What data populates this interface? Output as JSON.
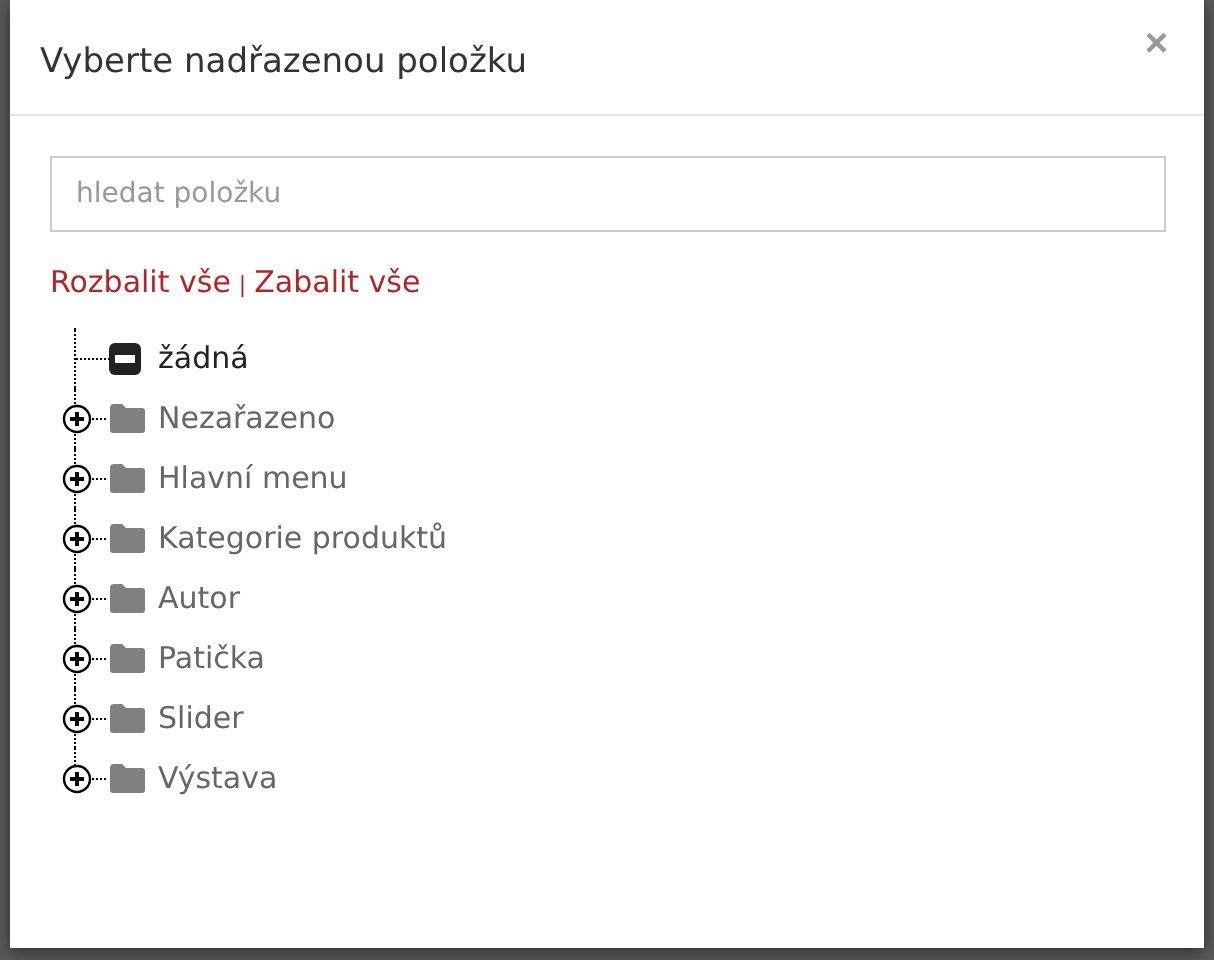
{
  "dialog": {
    "title": "Vyberte nadřazenou položku",
    "close": "×"
  },
  "search": {
    "placeholder": "hledat položku"
  },
  "actions": {
    "expand_all": "Rozbalit vše",
    "separator": "|",
    "collapse_all": "Zabalit vše"
  },
  "tree": [
    {
      "label": "žádná",
      "kind": "none"
    },
    {
      "label": "Nezařazeno",
      "kind": "folder",
      "expanded": false
    },
    {
      "label": "Hlavní menu",
      "kind": "folder",
      "expanded": false
    },
    {
      "label": "Kategorie produktů",
      "kind": "folder",
      "expanded": false
    },
    {
      "label": "Autor",
      "kind": "folder",
      "expanded": false
    },
    {
      "label": "Patička",
      "kind": "folder",
      "expanded": false
    },
    {
      "label": "Slider",
      "kind": "folder",
      "expanded": false
    },
    {
      "label": "Výstava",
      "kind": "folder",
      "expanded": false
    }
  ]
}
